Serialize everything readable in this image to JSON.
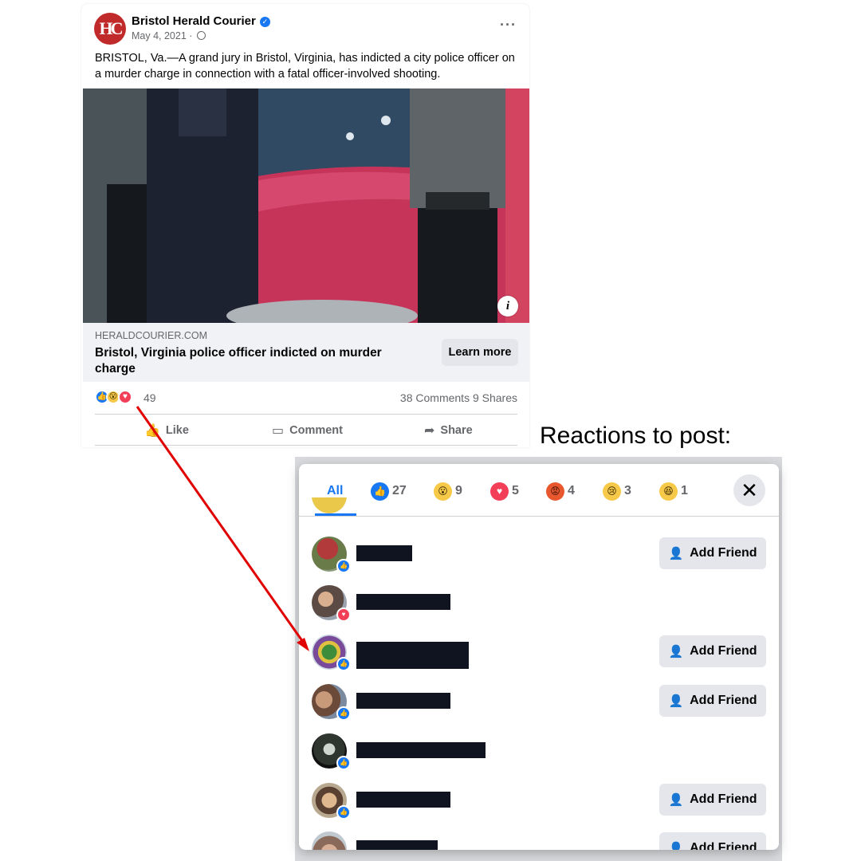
{
  "post": {
    "page_name": "Bristol Herald Courier",
    "logo_text": "HC",
    "date": "May 4, 2021 ·",
    "text": "BRISTOL, Va.—A grand jury in Bristol, Virginia, has indicted a city police officer on a murder charge in connection with a fatal officer-involved shooting.",
    "link_domain": "HERALDCOURIER.COM",
    "link_title": "Bristol, Virginia police officer indicted on murder charge",
    "learn_more": "Learn more",
    "reaction_total": "49",
    "counts": "38 Comments  9 Shares",
    "actions": {
      "like": "Like",
      "comment": "Comment",
      "share": "Share"
    }
  },
  "caption": "Reactions to post:",
  "dialog": {
    "tabs": {
      "all": "All",
      "like": "27",
      "wow": "9",
      "love": "5",
      "angry": "4",
      "sad": "3",
      "haha": "1"
    },
    "add_friend_label": "Add Friend",
    "rows": [
      {
        "reaction": "like",
        "has_button": true
      },
      {
        "reaction": "love",
        "has_button": false
      },
      {
        "reaction": "like",
        "has_button": true
      },
      {
        "reaction": "like",
        "has_button": true
      },
      {
        "reaction": "like",
        "has_button": false
      },
      {
        "reaction": "like",
        "has_button": true
      },
      {
        "reaction": "like",
        "has_button": true
      }
    ]
  },
  "icons": {
    "verified": "verified-badge-icon",
    "globe": "globe-icon",
    "more": "more-options-icon",
    "info": "info-icon",
    "like": "thumbs-up-icon",
    "comment": "comment-bubble-icon",
    "share": "share-arrow-icon",
    "close": "close-icon",
    "add_friend": "add-person-icon"
  },
  "colors": {
    "accent": "#1877f2",
    "love": "#f33e58",
    "arrow": "#e00000"
  }
}
